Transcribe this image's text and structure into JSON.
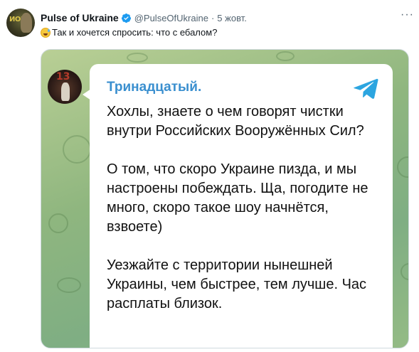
{
  "tweet": {
    "display_name": "Pulse of Ukraine",
    "handle": "@PulseOfUkraine",
    "separator": "·",
    "time": "5 жовт.",
    "text": "Так и хочется спросить: что с ебалом?",
    "verified_icon": "verified-badge-icon",
    "more_icon": "more-options-icon",
    "text_emoji": "grinning-sweat-emoji"
  },
  "media": {
    "channel_name": "Тринадцатый.",
    "telegram_icon": "telegram-logo-icon",
    "message": {
      "paragraph_1": "Хохлы, знаете о чем говорят чистки внутри Российских Вооружённых Сил?",
      "paragraph_2": "О том, что скоро Украине пизда, и мы настроены побеждать. Ща, погодите не много, скоро такое шоу начнётся, взвоете)",
      "paragraph_3": "Уезжайте с территории нынешней Украины, чем быстрее, тем лучше. Час расплаты близок."
    }
  },
  "colors": {
    "verified": "#1d9bf0",
    "telegram": "#2ca5e0",
    "channel_name": "#3a8fcf",
    "secondary_text": "#536471"
  }
}
